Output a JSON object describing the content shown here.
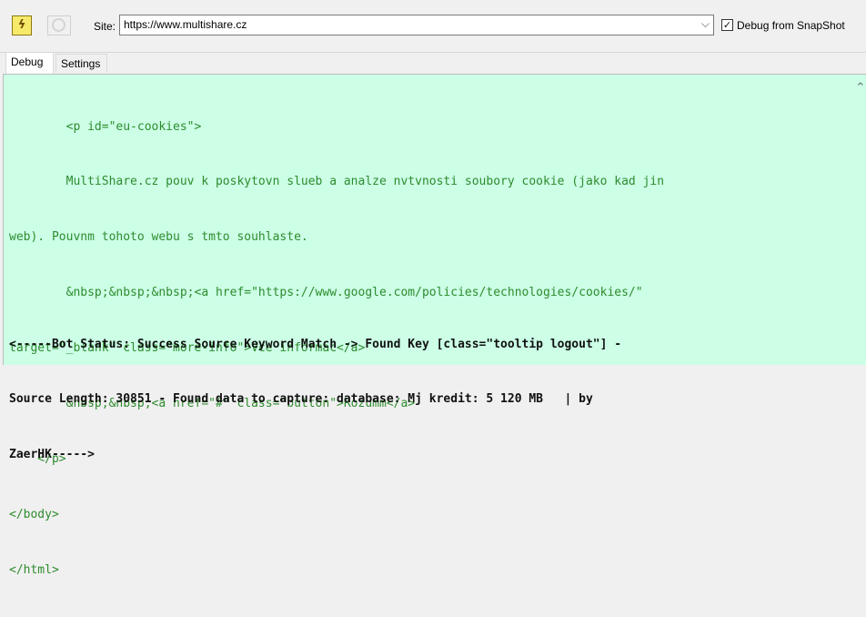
{
  "toolbar": {
    "run_icon": "lightning-icon",
    "stop_icon": "stop-icon",
    "site_label": "Site:",
    "site_value": "https://www.multishare.cz",
    "dropdown_icon": "chevron-down-icon",
    "debug_checkbox_checked": true,
    "debug_checkbox_mark": "✓",
    "debug_label": "Debug from SnapShot"
  },
  "tabs": [
    {
      "label": "Debug",
      "active": true
    },
    {
      "label": "Settings",
      "active": false
    }
  ],
  "debug_output": {
    "code_lines": [
      "        <p id=\"eu-cookies\">",
      "        MultiShare.cz pouv k poskytovn slueb a analze nvtvnosti soubory cookie (jako kad jin",
      "web). Pouvnm tohoto webu s tmto souhlaste.",
      "        &nbsp;&nbsp;&nbsp;<a href=\"https://www.google.com/policies/technologies/cookies/\"",
      "target=\"_blank\" class=\"more-info\">Vce informac</a>",
      "        &nbsp;&nbsp;<a href=\"#\" class=\"button\">Rozumm</a>",
      "    </p>",
      "</body>",
      "</html>"
    ],
    "status_lines": [
      "<-----Bot Status: Success Source Keyword Match -> Found Key [class=\"tooltip logout\"] -",
      "Source Length: 30851 - Found data to capture: database: Mj kredit: 5 120 MB   | by",
      "ZaerHK----->"
    ],
    "scroll_up_icon": "scroll-up-arrow-icon"
  },
  "colors": {
    "panel_background": "#ccffe6",
    "code_text": "#2e8b2e",
    "status_text": "#111111"
  }
}
